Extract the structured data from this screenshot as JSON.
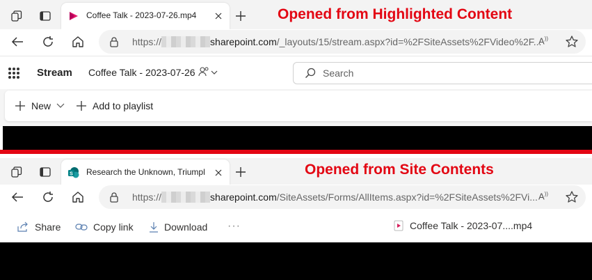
{
  "top": {
    "tab": {
      "title": "Coffee Talk - 2023-07-26.mp4"
    },
    "annotation": "Opened from Highlighted Content",
    "address": {
      "prefix": "https://",
      "host": "sharepoint.com",
      "path": "/_layouts/15/stream.aspx?id=%2FSiteAssets%2FVideo%2F..."
    },
    "stream": {
      "app_title": "Stream",
      "doc_title": "Coffee Talk - 2023-07-26",
      "search_placeholder": "Search",
      "new_label": "New",
      "add_playlist_label": "Add to playlist"
    }
  },
  "bottom": {
    "tab": {
      "title": "Research the Unknown, Triumph"
    },
    "annotation": "Opened from Site Contents",
    "address": {
      "prefix": "https://",
      "host": "sharepoint.com",
      "path": "/SiteAssets/Forms/AllItems.aspx?id=%2FSiteAssets%2FVi..."
    },
    "toolbar": {
      "share_label": "Share",
      "copy_link_label": "Copy link",
      "download_label": "Download",
      "more_label": "···",
      "file_name": "Coffee Talk - 2023-07....mp4"
    }
  },
  "colors": {
    "annotation_red": "#e30613",
    "stream_brand": "#e2196b",
    "sharepoint_teal": "#038387",
    "video_black": "#000000"
  }
}
